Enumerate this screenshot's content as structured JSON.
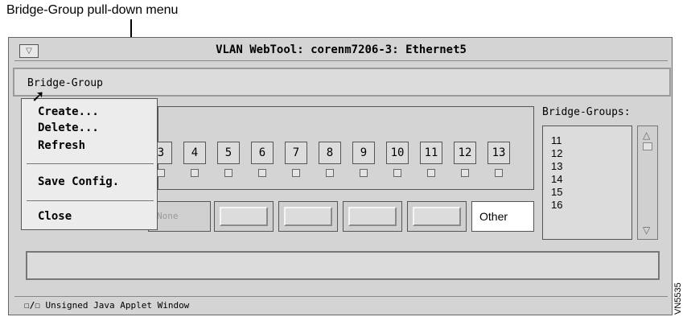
{
  "caption": "Bridge-Group pull-down menu",
  "window": {
    "title": "VLAN WebTool: corenm7206-3: Ethernet5",
    "menu_button_icon": "window-menu-icon",
    "menubar": [
      "Bridge-Group"
    ],
    "dropdown_menu": {
      "group1": [
        "Create...",
        "Delete...",
        "Refresh"
      ],
      "group2": [
        "Save Config."
      ],
      "group3": [
        "Close"
      ]
    },
    "ports": [
      "3",
      "4",
      "5",
      "6",
      "7",
      "8",
      "9",
      "10",
      "11",
      "12",
      "13"
    ],
    "bridge_group_buttons": [
      "None",
      "",
      "",
      "",
      "",
      "Other"
    ],
    "bridge_groups_label": "Bridge-Groups:",
    "bridge_groups_list": [
      "11",
      "12",
      "13",
      "14",
      "15",
      "16"
    ],
    "status_field": "",
    "footer": {
      "icon": "java-applet-key-icon",
      "icon_text": "☐/☐",
      "text": "Unsigned Java Applet Window"
    }
  },
  "side_code": "VN5535"
}
